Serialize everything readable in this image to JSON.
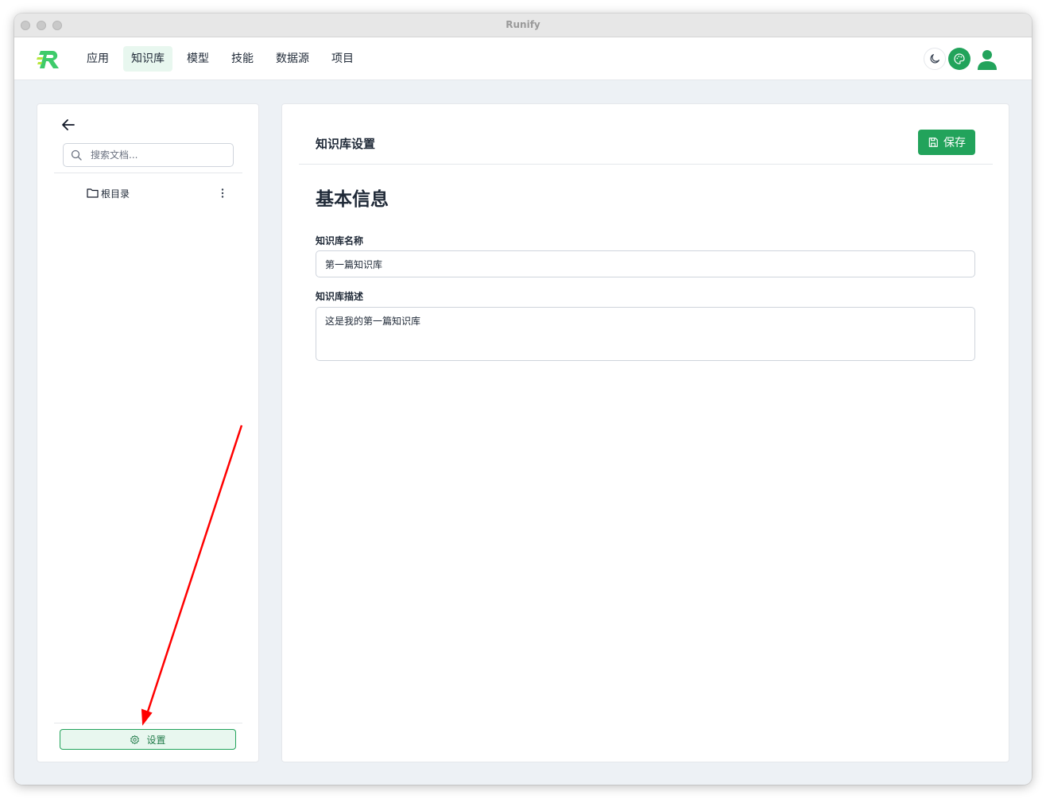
{
  "window": {
    "title": "Runify"
  },
  "nav": {
    "items": [
      {
        "label": "应用",
        "active": false
      },
      {
        "label": "知识库",
        "active": true
      },
      {
        "label": "模型",
        "active": false
      },
      {
        "label": "技能",
        "active": false
      },
      {
        "label": "数据源",
        "active": false
      },
      {
        "label": "项目",
        "active": false
      }
    ]
  },
  "sidebar": {
    "search_placeholder": "搜索文档...",
    "tree": [
      {
        "label": "根目录",
        "icon": "folder-icon"
      }
    ],
    "settings_label": "设置"
  },
  "main": {
    "page_title": "知识库设置",
    "save_label": "保存",
    "section_title": "基本信息",
    "name_label": "知识库名称",
    "name_value": "第一篇知识库",
    "desc_label": "知识库描述",
    "desc_value": "这是我的第一篇知识库"
  },
  "colors": {
    "accent": "#22a35b",
    "active_bg": "#e8f7ef",
    "annotation_arrow": "#ff0000"
  }
}
